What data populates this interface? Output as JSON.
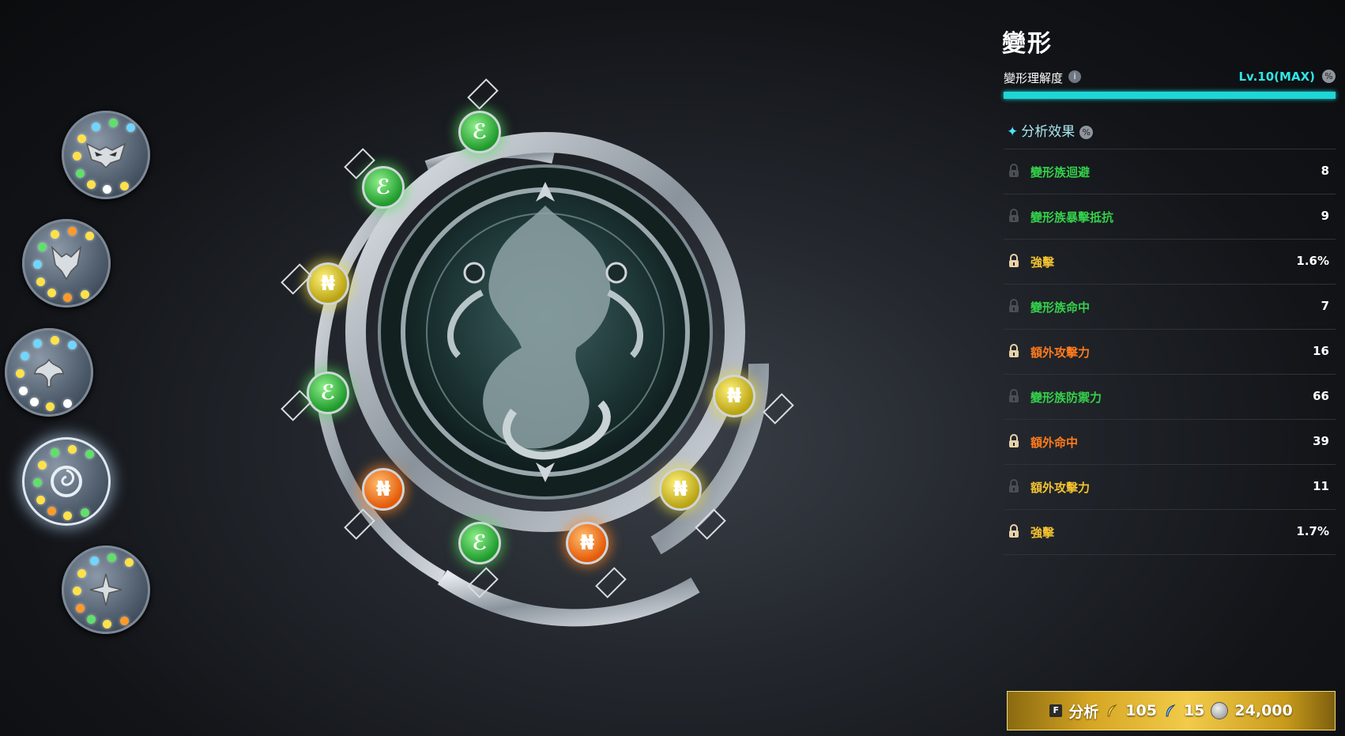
{
  "panel": {
    "title": "變形",
    "level_label": "變形理解度",
    "level_value": "Lv.10(MAX)",
    "level_progress_percent": 100,
    "section_title": "分析效果",
    "effects": [
      {
        "name": "變形族迴避",
        "value": "8",
        "color": "#35d04a",
        "locked": false
      },
      {
        "name": "變形族暴擊抵抗",
        "value": "9",
        "color": "#35d04a",
        "locked": false
      },
      {
        "name": "強擊",
        "value": "1.6%",
        "color": "#f2c230",
        "locked": true
      },
      {
        "name": "變形族命中",
        "value": "7",
        "color": "#35d04a",
        "locked": false
      },
      {
        "name": "額外攻擊力",
        "value": "16",
        "color": "#ff7a1c",
        "locked": true
      },
      {
        "name": "變形族防禦力",
        "value": "66",
        "color": "#35d04a",
        "locked": false
      },
      {
        "name": "額外命中",
        "value": "39",
        "color": "#ff7a1c",
        "locked": true
      },
      {
        "name": "額外攻擊力",
        "value": "11",
        "color": "#f2c230",
        "locked": false
      },
      {
        "name": "強擊",
        "value": "1.7%",
        "color": "#f2c230",
        "locked": true
      }
    ]
  },
  "analyze_button": {
    "key": "F",
    "label": "分析",
    "cost1": "105",
    "cost2": "15",
    "cost3": "24,000"
  },
  "colors": {
    "accent": "#1fd6d6",
    "green": "#35d04a",
    "yellow": "#f2c230",
    "orange": "#ff7a1c"
  }
}
